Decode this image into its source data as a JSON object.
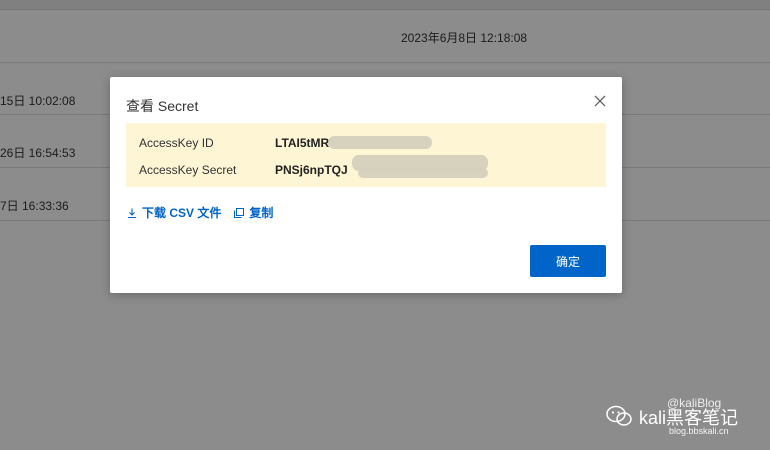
{
  "background": {
    "rows": [
      {
        "text": "2023年6月8日 12:18:08"
      },
      {
        "text": "15日 10:02:08"
      },
      {
        "text": "26日 16:54:53"
      },
      {
        "text": "7日 16:33:36"
      }
    ]
  },
  "dialog": {
    "title": "查看 Secret",
    "access_key_id_label": "AccessKey ID",
    "access_key_id_value": "LTAI5tMR",
    "access_key_secret_label": "AccessKey Secret",
    "access_key_secret_value": "PNSj6npTQJ",
    "download_csv_label": "下载 CSV 文件",
    "copy_label": "复制",
    "confirm_label": "确定"
  },
  "watermark": {
    "handle": "@kaliBlog",
    "main": "kali黑客笔记",
    "sub": "blog.bbskali.cn"
  },
  "colors": {
    "accent": "#0064c8",
    "key_box_bg": "#fdf5d4",
    "overlay": "rgba(0,0,0,0.45)"
  }
}
